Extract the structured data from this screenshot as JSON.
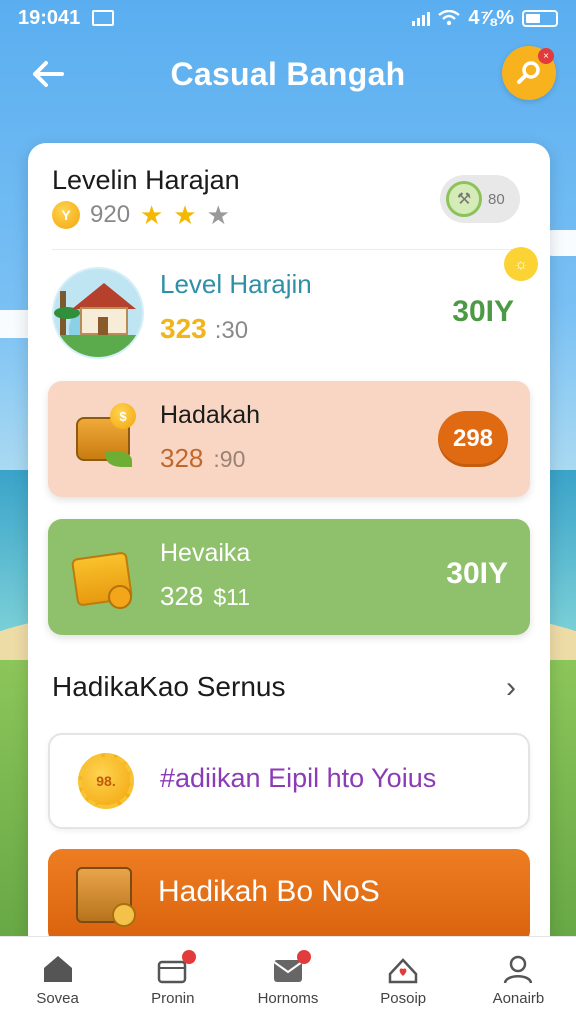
{
  "status_bar": {
    "time": "19:041",
    "battery": "4⅞%"
  },
  "header": {
    "title": "Casual Bangah"
  },
  "profile": {
    "name": "Levelin Harajan",
    "coins": "920",
    "stars_filled": 2,
    "stars_total": 3,
    "toggle_text": "80"
  },
  "level_row": {
    "title": "Level Harajin",
    "score_main": "323",
    "score_sub": ":30",
    "value": "30IY"
  },
  "items": [
    {
      "title": "Hadakah",
      "score_main": "328",
      "score_sub": ":90",
      "badge": "298"
    },
    {
      "title": "Hevaika",
      "score_main": "328",
      "score_sub": "$11",
      "value": "30IY"
    }
  ],
  "section": {
    "title": "HadikaKao Sernus"
  },
  "promos": {
    "outline_text": "#adiikan Eipil hto Yoius",
    "outline_icon_text": "98.",
    "orange_text": "Hadikah Bo NoS"
  },
  "bottom_nav": [
    {
      "label": "Sovea",
      "icon": "home-icon"
    },
    {
      "label": "Pronin",
      "icon": "calendar-icon"
    },
    {
      "label": "Hornoms",
      "icon": "inbox-icon"
    },
    {
      "label": "Posoip",
      "icon": "heart-icon"
    },
    {
      "label": "Aonairb",
      "icon": "profile-icon"
    }
  ],
  "colors": {
    "accent_orange": "#e06a11",
    "accent_green": "#8fc06b",
    "peach": "#f8d6c3",
    "promo_purple": "#8c3bb6",
    "level_teal": "#2f8fa6"
  }
}
